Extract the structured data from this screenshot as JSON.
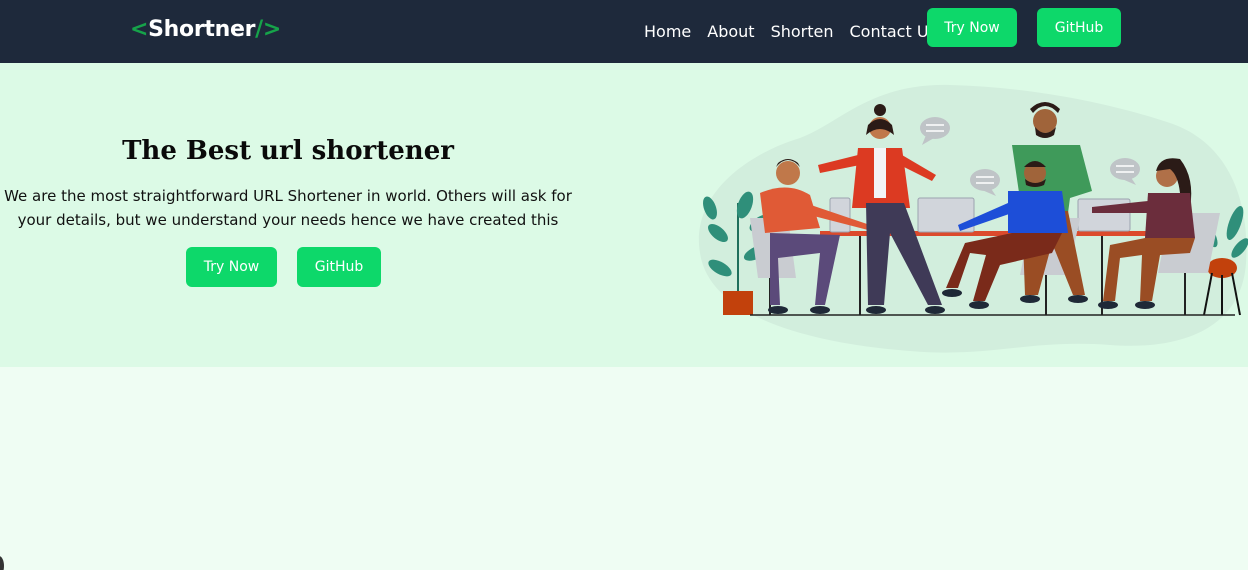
{
  "nav": {
    "brand_open": "<",
    "brand_name": "Shortner",
    "brand_close": "/>",
    "links": [
      "Home",
      "About",
      "Shorten",
      "Contact Us"
    ],
    "try_label": "Try Now",
    "github_label": "GitHub"
  },
  "hero": {
    "title": "The Best url shortener",
    "description": "We are the most straightforward URL Shortener in world. Others will ask for your details, but we understand your needs hence we have created this",
    "try_label": "Try Now",
    "github_label": "GitHub",
    "illustration_icon": "team-meeting-illustration"
  },
  "colors": {
    "nav_bg": "#1e293b",
    "accent": "#0dd86a",
    "brand_code": "#16a34a",
    "hero_bg": "#dcfae6",
    "page_bg": "#effdf3"
  }
}
